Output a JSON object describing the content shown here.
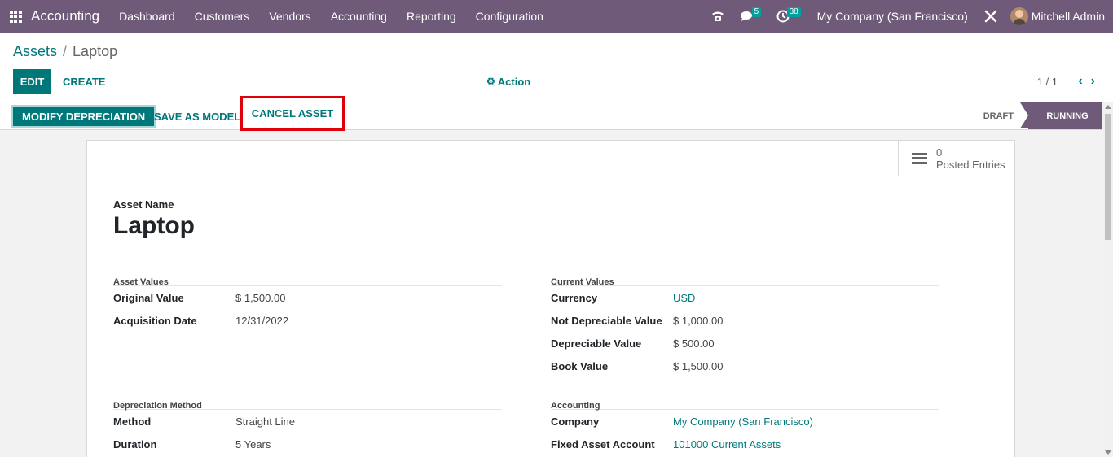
{
  "navbar": {
    "app_name": "Accounting",
    "menu": [
      "Dashboard",
      "Customers",
      "Vendors",
      "Accounting",
      "Reporting",
      "Configuration"
    ],
    "messages_count": "5",
    "activities_count": "38",
    "company": "My Company (San Francisco)",
    "user": "Mitchell Admin"
  },
  "breadcrumb": {
    "parent": "Assets",
    "separator": "/",
    "current": "Laptop"
  },
  "toolbar": {
    "edit_label": "EDIT",
    "create_label": "CREATE",
    "action_label": "Action",
    "pager": "1 / 1"
  },
  "statusbar": {
    "modify_label": "MODIFY DEPRECIATION",
    "save_model_label": "SAVE AS MODEL",
    "cancel_label": "CANCEL ASSET",
    "stages": [
      "DRAFT",
      "RUNNING"
    ],
    "active_stage": "RUNNING"
  },
  "sheet": {
    "posted_entries_count": "0",
    "posted_entries_label": "Posted Entries",
    "name_label": "Asset Name",
    "name": "Laptop",
    "asset_values": {
      "title": "Asset Values",
      "fields": [
        {
          "label": "Original Value",
          "value": "$ 1,500.00"
        },
        {
          "label": "Acquisition Date",
          "value": "12/31/2022"
        }
      ]
    },
    "current_values": {
      "title": "Current Values",
      "fields": [
        {
          "label": "Currency",
          "value": "USD"
        },
        {
          "label": "Not Depreciable Value",
          "value": "$ 1,000.00"
        },
        {
          "label": "Depreciable Value",
          "value": "$ 500.00"
        },
        {
          "label": "Book Value",
          "value": "$ 1,500.00"
        }
      ]
    },
    "depreciation_method": {
      "title": "Depreciation Method",
      "fields": [
        {
          "label": "Method",
          "value": "Straight Line"
        },
        {
          "label": "Duration",
          "value": "5 Years"
        }
      ]
    },
    "accounting": {
      "title": "Accounting",
      "fields": [
        {
          "label": "Company",
          "value": "My Company (San Francisco)"
        },
        {
          "label": "Fixed Asset Account",
          "value": "101000 Current Assets"
        }
      ]
    }
  },
  "colors": {
    "navbar": "#6f5b79",
    "primary": "#00787a",
    "highlight_border": "#e0000a"
  }
}
